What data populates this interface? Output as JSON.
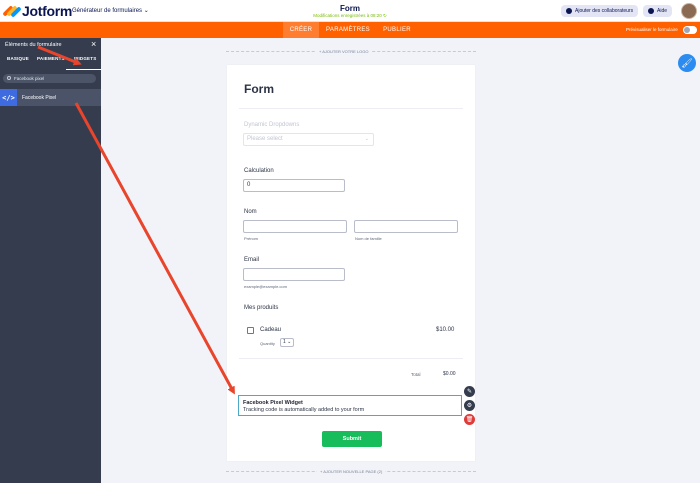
{
  "header": {
    "logo_text": "Jotform",
    "builder_label": "Générateur de formulaires ⌄",
    "form_title": "Form",
    "saved_status": "Modifications enregistrées à 08:20 ↻",
    "collab_button": "Ajouter des collaborateurs",
    "help_button": "Aide"
  },
  "tabs": [
    "CRÉER",
    "PARAMÈTRES",
    "PUBLIER"
  ],
  "preview_label": "Prévisualiser le formulaire",
  "sidebar": {
    "title": "Éléments du formulaire",
    "close_icon": "×",
    "tabs": [
      "BASIQUE",
      "PAIEMENTS",
      "WIDGETS"
    ],
    "active_tab": "WIDGETS",
    "search_value": "Facebook pixel",
    "results": [
      {
        "icon_text": "</>",
        "label": "Facebook Pixel"
      }
    ]
  },
  "canvas": {
    "add_logo": "+ AJOUTER VOTRE LOGO",
    "add_page": "+ AJOUTER NOUVELLE PAGE (2)"
  },
  "form": {
    "heading": "Form",
    "dropdown": {
      "label": "Dynamic Dropdowns",
      "placeholder": "Please select"
    },
    "calculation": {
      "label": "Calculation",
      "value": "0"
    },
    "name": {
      "label": "Nom",
      "first_sub": "Prénom",
      "last_sub": "Nom de famille"
    },
    "email": {
      "label": "Email",
      "sub": "example@example.com"
    },
    "products": {
      "label": "Mes produits",
      "item_name": "Cadeau",
      "item_price": "$10.00",
      "quantity_label": "Quantity",
      "quantity_value": "1 ⌄",
      "total_label": "Total",
      "total_value": "$0.00"
    },
    "pixel_widget": {
      "title": "Facebook Pixel Widget",
      "description": "Tracking code is automatically added to your form"
    },
    "submit": "Submit"
  },
  "colors": {
    "orange": "#ff6100",
    "sidebar": "#343c4e",
    "submit_green": "#18bd5b",
    "arrow_red": "#e8452c"
  }
}
